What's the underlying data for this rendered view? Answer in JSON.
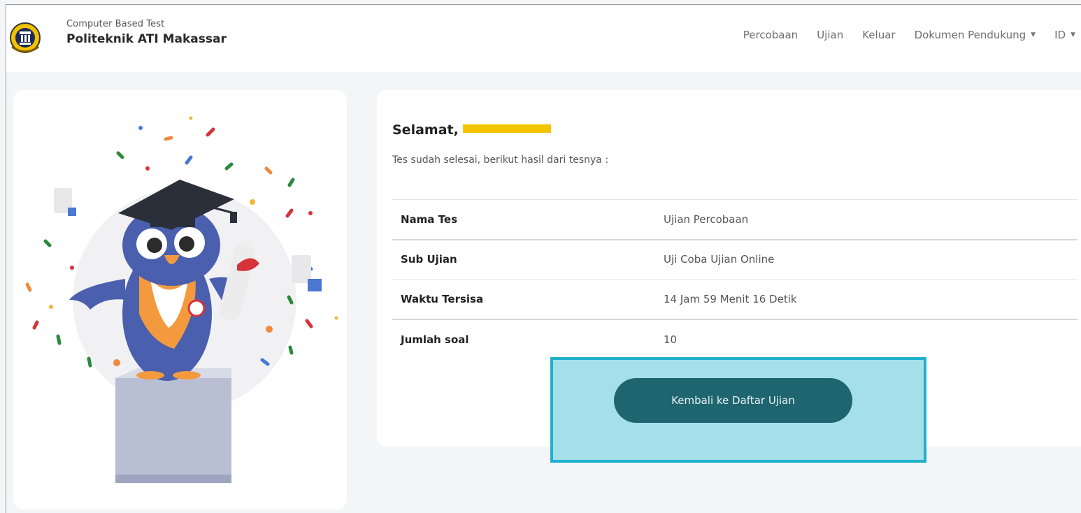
{
  "header": {
    "subtitle": "Computer Based Test",
    "title": "Politeknik ATI Makassar",
    "nav": [
      {
        "label": "Percobaan",
        "dropdown": false
      },
      {
        "label": "Ujian",
        "dropdown": false
      },
      {
        "label": "Keluar",
        "dropdown": false
      },
      {
        "label": "Dokumen Pendukung",
        "dropdown": true
      },
      {
        "label": "ID",
        "dropdown": true
      }
    ]
  },
  "result": {
    "greeting": "Selamat,",
    "description": "Tes sudah selesai, berikut hasil dari tesnya :",
    "rows": [
      {
        "label": "Nama Tes",
        "value": "Ujian Percobaan"
      },
      {
        "label": "Sub Ujian",
        "value": "Uji Coba Ujian Online"
      },
      {
        "label": "Waktu Tersisa",
        "value": "14 Jam 59 Menit 16 Detik"
      },
      {
        "label": "Jumlah soal",
        "value": "10"
      }
    ],
    "back_button": "Kembali ke Daftar Ujian"
  },
  "colors": {
    "button": "#1f6570",
    "highlight_fill": "#a5e0ea",
    "highlight_border": "#1fb0cc",
    "redaction": "#f5c400"
  },
  "icons": {
    "logo": "institution-logo",
    "illustration": "graduate-owl-illustration",
    "caret": "caret-down-icon"
  }
}
